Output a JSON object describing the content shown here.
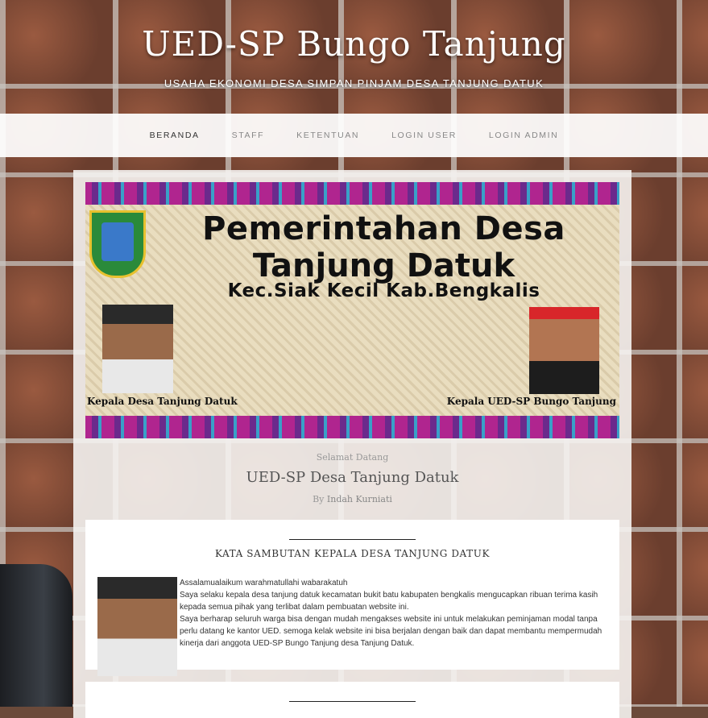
{
  "header": {
    "title": "UED-SP Bungo Tanjung",
    "tagline": "USAHA EKONOMI DESA SIMPAN PINJAM DESA TANJUNG DATUK"
  },
  "nav": {
    "items": [
      {
        "label": "BERANDA",
        "active": true
      },
      {
        "label": "STAFF"
      },
      {
        "label": "KETENTUAN"
      },
      {
        "label": "LOGIN USER"
      },
      {
        "label": "LOGIN ADMIN"
      }
    ]
  },
  "banner": {
    "title_line1": "Pemerintahan Desa",
    "title_line2": "Tanjung Datuk",
    "subtitle": "Kec.Siak Kecil Kab.Bengkalis",
    "caption_left": "Kepala Desa Tanjung Datuk",
    "caption_right": "Kepala UED-SP Bungo Tanjung"
  },
  "post": {
    "welcome": "Selamat Datang",
    "title": "UED-SP Desa Tanjung Datuk",
    "by_prefix": "By",
    "author": "Indah Kurniati"
  },
  "card": {
    "heading": "KATA SAMBUTAN KEPALA DESA TANJUNG DATUK",
    "paragraphs": [
      "Assalamualaikum warahmatullahi wabarakatuh",
      "Saya selaku kepala desa tanjung datuk kecamatan bukit batu kabupaten bengkalis mengucapkan ribuan terima kasih kepada semua pihak yang terlibat dalam pembuatan website ini.",
      "Saya berharap seluruh warga bisa dengan mudah mengakses website ini untuk melakukan peminjaman modal tanpa perlu datang ke kantor UED. semoga kelak website ini bisa berjalan dengan baik dan dapat membantu mempermudah kinerja dari anggota UED-SP Bungo Tanjung desa Tanjung Datuk."
    ]
  }
}
